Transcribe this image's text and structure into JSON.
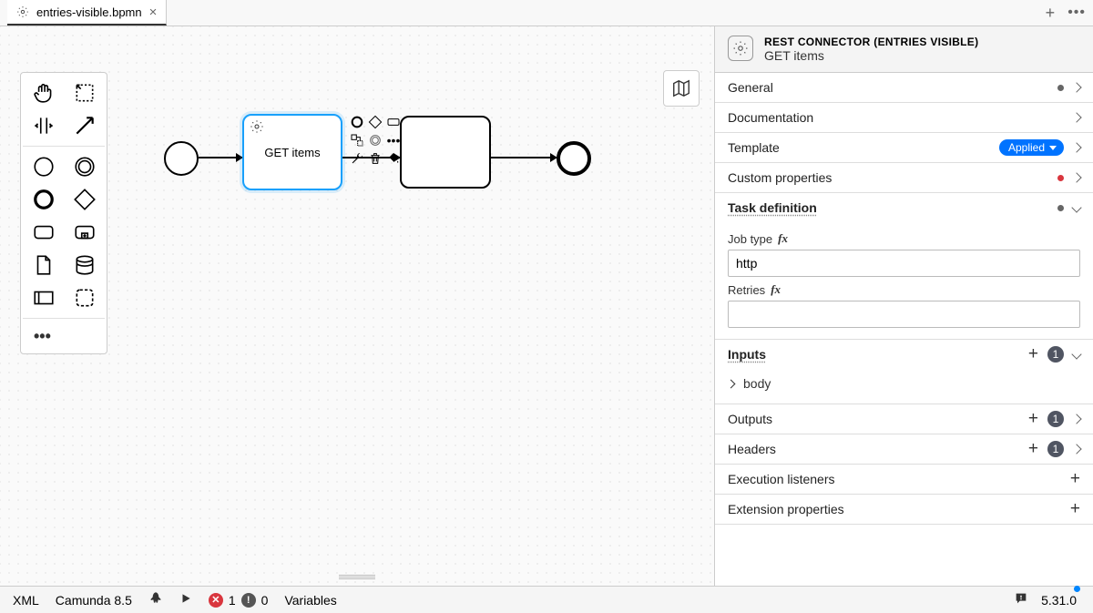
{
  "tab": {
    "title": "entries-visible.bpmn"
  },
  "canvas": {
    "task1_label": "GET items"
  },
  "props": {
    "header_template": "REST CONNECTOR (ENTRIES VISIBLE)",
    "header_name": "GET items",
    "groups": {
      "general": "General",
      "documentation": "Documentation",
      "template": "Template",
      "template_badge": "Applied",
      "custom_properties": "Custom properties",
      "task_definition": "Task definition",
      "inputs": "Inputs",
      "outputs": "Outputs",
      "headers": "Headers",
      "execution_listeners": "Execution listeners",
      "extension_properties": "Extension properties"
    },
    "taskdef": {
      "job_type_label": "Job type",
      "job_type_value": "http",
      "retries_label": "Retries",
      "retries_value": ""
    },
    "inputs_count": "1",
    "outputs_count": "1",
    "headers_count": "1",
    "input_items": [
      {
        "name": "body"
      }
    ]
  },
  "status": {
    "xml": "XML",
    "platform": "Camunda 8.5",
    "errors": "1",
    "warnings": "0",
    "variables": "Variables",
    "version": "5.31.0"
  }
}
